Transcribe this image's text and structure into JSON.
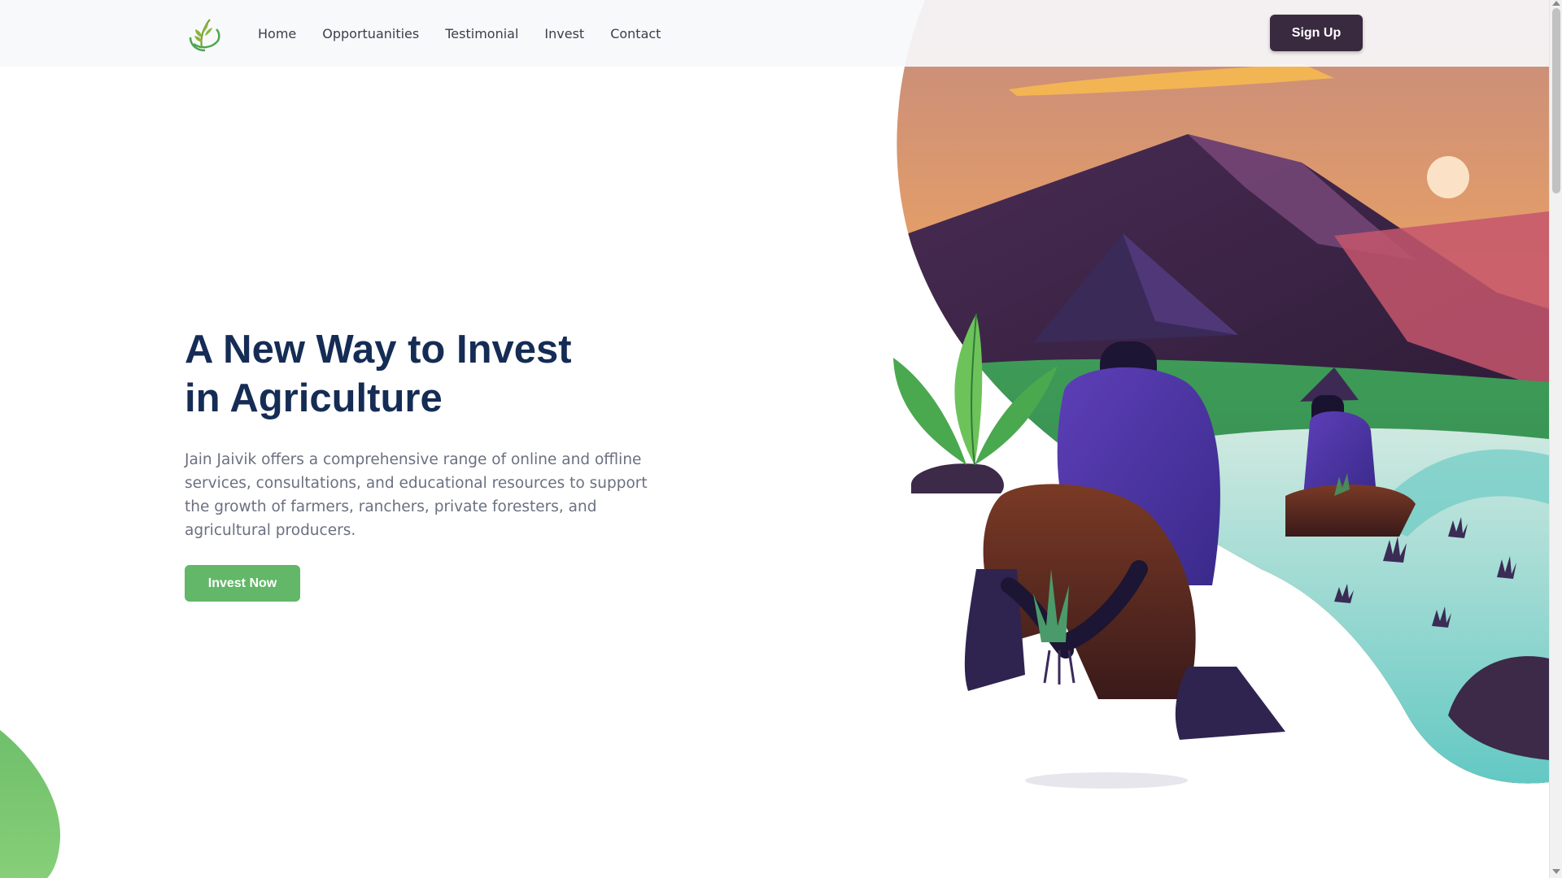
{
  "nav": {
    "logo_icon": "wheat-leaf-logo-icon",
    "links": [
      "Home",
      "Opportuanities",
      "Testimonial",
      "Invest",
      "Contact"
    ],
    "signup_label": "Sign Up"
  },
  "hero": {
    "title_line1": "A New Way to Invest",
    "title_line2": "in Agriculture",
    "description": "Jain Jaivik offers a comprehensive range of online and offline services, consultations, and educational resources to support the growth of farmers, ranchers, private foresters, and agricultural producers.",
    "cta_label": "Invest Now"
  },
  "colors": {
    "primary_dark": "#3a2a3f",
    "accent_green": "#63b768",
    "title_navy": "#152c55",
    "text_gray": "#6b7080"
  }
}
